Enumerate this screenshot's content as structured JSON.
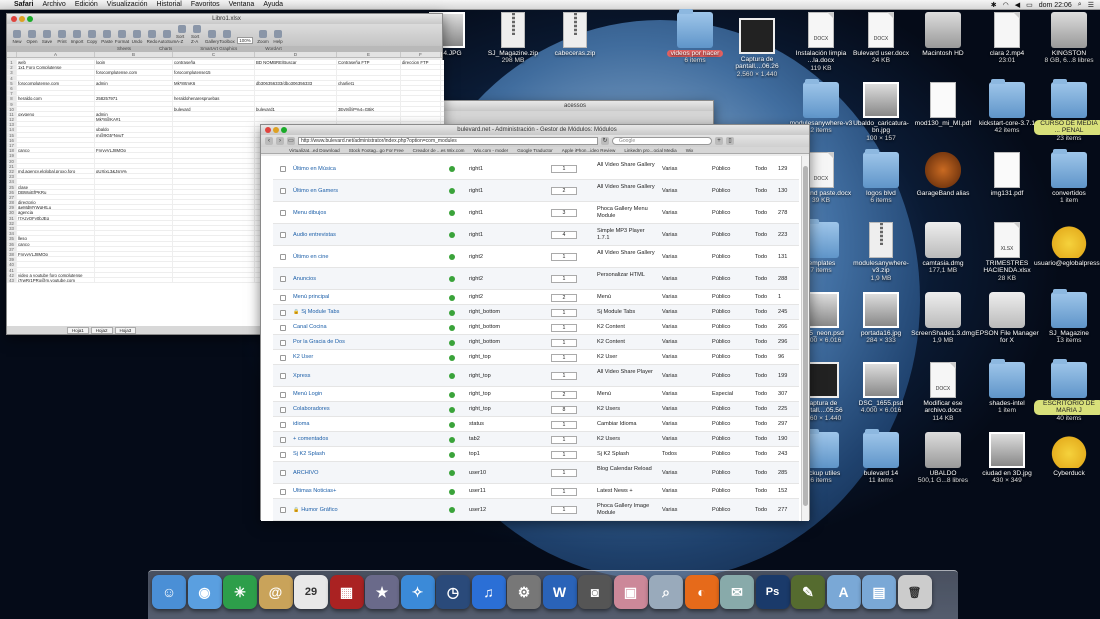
{
  "menubar": {
    "app": "Safari",
    "items": [
      "Archivo",
      "Edición",
      "Visualización",
      "Historial",
      "Favoritos",
      "Ventana",
      "Ayuda"
    ],
    "clock": "dom 22:06"
  },
  "spreadsheet": {
    "title": "Libro1.xlsx",
    "toolbar": [
      "New",
      "Open",
      "Save",
      "Print",
      "Import",
      "Copy",
      "Paste",
      "Format",
      "Undo",
      "Redo",
      "AutoSum",
      "Sort A-Z",
      "Sort Z-A",
      "Gallery",
      "Toolbox",
      "Zoom",
      "Help"
    ],
    "zoom": "100%",
    "ribbon": [
      "Sheets",
      "Charts",
      "SmartArt Graphics",
      "WordArt"
    ],
    "columns": [
      "A",
      "B",
      "C",
      "D",
      "E",
      "F"
    ],
    "headers": [
      "web",
      "login",
      "contraseña",
      "BD NOMBRE/Buscar",
      "Contraseña FTP",
      "direccion FTP"
    ],
    "rows": [
      [
        "1",
        "web",
        "login",
        "contraseña",
        "BD NOMBRE/Buscar",
        "Contraseña FTP",
        "direccion FTP"
      ],
      [
        "2",
        "1x1 Foro Complutense",
        "",
        "",
        "",
        "",
        ""
      ],
      [
        "3",
        "",
        "forocomplutense.com",
        "forocomplutense15",
        "",
        "",
        ""
      ],
      [
        "4",
        "",
        "",
        "",
        "",
        "",
        ""
      ],
      [
        "5",
        "forocomplutense.com",
        "admin",
        "Mk*8rtmK6",
        "db306356333/dbo306356333",
        "charliet1",
        ""
      ],
      [
        "6",
        "",
        "",
        "",
        "",
        "",
        ""
      ],
      [
        "7",
        "",
        "",
        "",
        "",
        "",
        ""
      ],
      [
        "8",
        "heraldo.com",
        "258257971",
        "heraldohenarespruebas",
        "",
        "",
        ""
      ],
      [
        "9",
        "",
        "",
        "",
        "",
        "",
        ""
      ],
      [
        "10",
        "",
        "",
        "bulevard",
        "bulevard1",
        "3Ev9@jP%4=G8iK",
        ""
      ],
      [
        "11",
        "oxygeno",
        "admin",
        "",
        "",
        "",
        ""
      ],
      [
        "12",
        "",
        "Mk*8@KA#1",
        "",
        "",
        "",
        ""
      ],
      [
        "13",
        "",
        "",
        "",
        "",
        "",
        ""
      ],
      [
        "14",
        "",
        "ubaldo",
        "",
        "",
        "",
        ""
      ],
      [
        "15",
        "",
        "m@9G5*NvuT",
        "",
        "",
        "",
        ""
      ],
      [
        "16",
        "",
        "",
        "",
        "",
        "",
        ""
      ],
      [
        "17",
        "",
        "",
        "",
        "",
        "",
        ""
      ],
      [
        "18",
        "canco",
        "FnrvyVLJ8MOp",
        "",
        "",
        "",
        ""
      ],
      [
        "19",
        "",
        "",
        "",
        "",
        "",
        ""
      ],
      [
        "20",
        "",
        "",
        "",
        "",
        "",
        ""
      ],
      [
        "21",
        "",
        "",
        "",
        "",
        "",
        ""
      ],
      [
        "22",
        "md,agency,elglobal,proxo,foro",
        "gUXjxL3&Jsm%",
        "",
        "",
        "",
        ""
      ],
      [
        "23",
        "",
        "",
        "",
        "",
        "",
        ""
      ],
      [
        "24",
        "",
        "",
        "",
        "",
        "",
        ""
      ],
      [
        "25",
        "clase",
        "",
        "",
        "",
        "",
        ""
      ],
      [
        "26",
        "DBWxjEfPKRu",
        "",
        "",
        "",
        "",
        ""
      ],
      [
        "27",
        "",
        "",
        "",
        "",
        "",
        ""
      ],
      [
        "28",
        "directorio",
        "",
        "",
        "",
        "",
        ""
      ],
      [
        "29",
        "&eMdMYWqHtLu",
        "",
        "",
        "",
        "",
        ""
      ],
      [
        "30",
        "agencia",
        "",
        "",
        "",
        "",
        ""
      ],
      [
        "31",
        "!7AzyOFy0bJEq",
        "",
        "",
        "",
        "",
        ""
      ],
      [
        "32",
        "",
        "",
        "",
        "",
        "",
        ""
      ],
      [
        "33",
        "",
        "",
        "",
        "",
        "",
        ""
      ],
      [
        "34",
        "",
        "",
        "",
        "",
        "",
        ""
      ],
      [
        "35",
        "lleso",
        "",
        "",
        "",
        "",
        ""
      ],
      [
        "36",
        "canco",
        "",
        "",
        "",
        "",
        ""
      ],
      [
        "37",
        "",
        "",
        "",
        "",
        "",
        ""
      ],
      [
        "38",
        "FnrvyVLJ8MOp",
        "",
        "",
        "",
        "",
        ""
      ],
      [
        "39",
        "",
        "",
        "",
        "",
        "",
        ""
      ],
      [
        "40",
        "",
        "",
        "",
        "",
        "",
        ""
      ],
      [
        "41",
        "",
        "",
        "",
        "",
        "",
        ""
      ],
      [
        "42",
        "video a youtube foro complutense",
        "",
        "",
        "",
        "",
        ""
      ],
      [
        "43",
        "j7rwRr1PRo@m.youtube.com",
        "",
        "",
        "",
        "",
        ""
      ]
    ],
    "sheets": [
      "Hoja1",
      "Hoja2",
      "Hoja3"
    ]
  },
  "browser": {
    "title": "bulevard.net - Administración - Gestor de Módulos: Módulos",
    "url": "http://www.bulevard.net/administrator/index.php?option=com_modules",
    "search_placeholder": "Google",
    "bookmarks": [
      "Virtualizat...ed Download",
      "Stock Footag...go For Free",
      "Creador de ...es Wix.com",
      "Wix.com - moder",
      "Google Traductor",
      "Apple iPhon...ideo Review",
      "LinkedIn pro...ocial Media",
      "Wix"
    ],
    "modules": [
      {
        "title": "Último en Música",
        "locked": false,
        "position": "right1",
        "order": "1",
        "type": "All Video Share Gallery",
        "pages": "Varias",
        "access": "Público",
        "lang": "Todo",
        "id": "129"
      },
      {
        "title": "Último en Gamers",
        "locked": false,
        "position": "right1",
        "order": "2",
        "type": "All Video Share Gallery",
        "pages": "Varias",
        "access": "Público",
        "lang": "Todo",
        "id": "130"
      },
      {
        "title": "Menu dibujos",
        "locked": false,
        "position": "right1",
        "order": "3",
        "type": "Phoca Gallery Menu Module",
        "pages": "Varias",
        "access": "Público",
        "lang": "Todo",
        "id": "278"
      },
      {
        "title": "Audio entrevistas",
        "locked": false,
        "position": "right1",
        "order": "4",
        "type": "Simple MP3 Player 1.7.1",
        "pages": "Varias",
        "access": "Público",
        "lang": "Todo",
        "id": "223"
      },
      {
        "title": "Último en cine",
        "locked": false,
        "position": "right2",
        "order": "1",
        "type": "All Video Share Gallery",
        "pages": "Varias",
        "access": "Público",
        "lang": "Todo",
        "id": "131"
      },
      {
        "title": "Anuncios",
        "locked": false,
        "position": "right2",
        "order": "1",
        "type": "Personalizar HTML",
        "pages": "Varias",
        "access": "Público",
        "lang": "Todo",
        "id": "288"
      },
      {
        "title": "Menú principal",
        "locked": false,
        "position": "right2",
        "order": "2",
        "type": "Menú",
        "pages": "Varias",
        "access": "Público",
        "lang": "Todo",
        "id": "1"
      },
      {
        "title": "Sj Module Tabs",
        "locked": true,
        "position": "right_bottom",
        "order": "1",
        "type": "Sj Module Tabs",
        "pages": "Varias",
        "access": "Público",
        "lang": "Todo",
        "id": "245"
      },
      {
        "title": "Canal Cocina",
        "locked": false,
        "position": "right_bottom",
        "order": "1",
        "type": "K2 Content",
        "pages": "Varias",
        "access": "Público",
        "lang": "Todo",
        "id": "266"
      },
      {
        "title": "Por la Gracia de Dos",
        "locked": false,
        "position": "right_bottom",
        "order": "1",
        "type": "K2 Content",
        "pages": "Varias",
        "access": "Público",
        "lang": "Todo",
        "id": "296"
      },
      {
        "title": "K2 User",
        "locked": false,
        "position": "right_top",
        "order": "1",
        "type": "K2 User",
        "pages": "Varias",
        "access": "Público",
        "lang": "Todo",
        "id": "96"
      },
      {
        "title": "Xpress",
        "locked": false,
        "position": "right_top",
        "order": "1",
        "type": "All Video Share Player",
        "pages": "Varias",
        "access": "Público",
        "lang": "Todo",
        "id": "199"
      },
      {
        "title": "Menú Login",
        "locked": false,
        "position": "right_top",
        "order": "2",
        "type": "Menú",
        "pages": "Varias",
        "access": "Especial",
        "lang": "Todo",
        "id": "307"
      },
      {
        "title": "Colaboradores",
        "locked": false,
        "position": "right_top",
        "order": "8",
        "type": "K2 Users",
        "pages": "Varias",
        "access": "Público",
        "lang": "Todo",
        "id": "225"
      },
      {
        "title": "idioma",
        "locked": false,
        "position": "status",
        "order": "1",
        "type": "Cambiar Idioma",
        "pages": "Varias",
        "access": "Público",
        "lang": "Todo",
        "id": "297"
      },
      {
        "title": "+ comentados",
        "locked": false,
        "position": "tab2",
        "order": "1",
        "type": "K2 Users",
        "pages": "Varias",
        "access": "Público",
        "lang": "Todo",
        "id": "190"
      },
      {
        "title": "Sj K2 Splash",
        "locked": false,
        "position": "top1",
        "order": "1",
        "type": "Sj K2 Splash",
        "pages": "Todos",
        "access": "Público",
        "lang": "Todo",
        "id": "243"
      },
      {
        "title": "ARCHIVO",
        "locked": false,
        "position": "user10",
        "order": "1",
        "type": "Blog Calendar Reload",
        "pages": "Varias",
        "access": "Público",
        "lang": "Todo",
        "id": "285"
      },
      {
        "title": "Ultimas Noticias+",
        "locked": false,
        "position": "user11",
        "order": "1",
        "type": "Latest News +",
        "pages": "Varias",
        "access": "Público",
        "lang": "Todo",
        "id": "152"
      },
      {
        "title": "Humor Gráfico",
        "locked": true,
        "position": "user12",
        "order": "1",
        "type": "Phoca Gallery Image Module",
        "pages": "Varias",
        "access": "Público",
        "lang": "Todo",
        "id": "277"
      }
    ]
  },
  "behind_window": {
    "title": "acessos"
  },
  "desktop_icons": [
    {
      "label": "1054.JPG",
      "sub": "",
      "kind": "photo"
    },
    {
      "label": "SJ_Magazine.zip",
      "sub": "298 MB",
      "kind": "zip"
    },
    {
      "label": "cabeceras.zip",
      "sub": "",
      "kind": "zip"
    },
    {
      "label": "videos por hacer",
      "sub": "6 items",
      "kind": "folder",
      "tag": "red"
    },
    {
      "label": "Captura de pantall....06.26",
      "sub": "2.560 × 1.440",
      "kind": "shot"
    },
    {
      "label": "Instalación limpia ...la.docx",
      "sub": "119 KB",
      "kind": "doc",
      "ext": "DOCX"
    },
    {
      "label": "Bulevard user.docx",
      "sub": "24 KB",
      "kind": "doc",
      "ext": "DOCX"
    },
    {
      "label": "Macintosh HD",
      "sub": "",
      "kind": "hd"
    },
    {
      "label": "clara 2.mp4",
      "sub": "23:01",
      "kind": "doc",
      "ext": ""
    },
    {
      "label": "KINGSTON",
      "sub": "8 GB, 6...8 libres",
      "kind": "hd"
    },
    {
      "label": "modulesanywhere-v3",
      "sub": "2 items",
      "kind": "folder"
    },
    {
      "label": "Ubaldo_caricatura-bn.jpg",
      "sub": "100 × 157",
      "kind": "photo"
    },
    {
      "label": "mod130_mi_MI.pdf",
      "sub": "",
      "kind": "pdf"
    },
    {
      "label": "kickstart-core-3.7.1",
      "sub": "42 items",
      "kind": "folder"
    },
    {
      "label": "CURSO DE MEDIA ... PENAL",
      "sub": "23 items",
      "kind": "folder",
      "tag": "yel"
    },
    {
      "label": "copy and paste.docx",
      "sub": "39 KB",
      "kind": "doc",
      "ext": "DOCX"
    },
    {
      "label": "logos blvd",
      "sub": "6 items",
      "kind": "folder"
    },
    {
      "label": "GarageBand alias",
      "sub": "",
      "kind": "gb"
    },
    {
      "label": "img131.pdf",
      "sub": "",
      "kind": "pdf"
    },
    {
      "label": "convertidos",
      "sub": "1 item",
      "kind": "folder"
    },
    {
      "label": "templates",
      "sub": "7 items",
      "kind": "folder"
    },
    {
      "label": "modulesanywhere-v3.zip",
      "sub": "1,9 MB",
      "kind": "zip"
    },
    {
      "label": "camtasia.dmg",
      "sub": "177,1 MB",
      "kind": "dmg"
    },
    {
      "label": "TRIMESTRES HACIENDA.xlsx",
      "sub": "28 KB",
      "kind": "doc",
      "ext": "XLSX"
    },
    {
      "label": "usuario@eglobalpress.org.duck",
      "sub": "",
      "kind": "duck"
    },
    {
      "label": "1655_neon.psd",
      "sub": "4.000 × 6.016",
      "kind": "photo"
    },
    {
      "label": "portada16.jpg",
      "sub": "284 × 333",
      "kind": "photo"
    },
    {
      "label": "ScreenShade1.3.dmg",
      "sub": "1,9 MB",
      "kind": "dmg"
    },
    {
      "label": "EPSON File Manager for X",
      "sub": "",
      "kind": "dmg"
    },
    {
      "label": "SJ_Magazine",
      "sub": "13 items",
      "kind": "folder"
    },
    {
      "label": "Captura de pantall....05.56",
      "sub": "2.560 × 1.440",
      "kind": "shot"
    },
    {
      "label": "DSC_1655.psd",
      "sub": "4.000 × 6.016",
      "kind": "photo"
    },
    {
      "label": "Modificar ese archivo.docx",
      "sub": "114 KB",
      "kind": "doc",
      "ext": "DOCX"
    },
    {
      "label": "shades-intel",
      "sub": "1 item",
      "kind": "folder"
    },
    {
      "label": "ESCRITORIO DE MARIA J",
      "sub": "40 items",
      "kind": "folder",
      "tag": "yel"
    },
    {
      "label": "backup utiles",
      "sub": "6 items",
      "kind": "folder"
    },
    {
      "label": "bulevard 14",
      "sub": "11 items",
      "kind": "folder"
    },
    {
      "label": "UBALDO",
      "sub": "500,1 G...8 libres",
      "kind": "hd"
    },
    {
      "label": "ciudad en 3D.jpg",
      "sub": "430 × 349",
      "kind": "photo"
    },
    {
      "label": "Cyberduck",
      "sub": "",
      "kind": "duck"
    }
  ],
  "dock": [
    {
      "name": "Finder",
      "icon": "finder-icon",
      "color": "#4a8fd6",
      "glyph": "☺"
    },
    {
      "name": "FaceTime",
      "icon": "facetime-icon",
      "color": "#5a9fe0",
      "glyph": "◉"
    },
    {
      "name": "Network",
      "icon": "network-icon",
      "color": "#2d9e4a",
      "glyph": "✳"
    },
    {
      "name": "Contacts",
      "icon": "contacts-icon",
      "color": "#c9a35a",
      "glyph": "@"
    },
    {
      "name": "Calendar",
      "icon": "calendar-icon",
      "color": "#e8e8e8",
      "glyph": "29"
    },
    {
      "name": "Photo Booth",
      "icon": "photobooth-icon",
      "color": "#a22",
      "glyph": "▦"
    },
    {
      "name": "iMovie",
      "icon": "imovie-icon",
      "color": "#6a6a8a",
      "glyph": "★"
    },
    {
      "name": "Safari",
      "icon": "safari-icon",
      "color": "#3b8ad8",
      "glyph": "✧"
    },
    {
      "name": "Time Machine",
      "icon": "timemachine-icon",
      "color": "#2a4a7a",
      "glyph": "◷"
    },
    {
      "name": "iTunes",
      "icon": "itunes-icon",
      "color": "#2b6fd6",
      "glyph": "♫"
    },
    {
      "name": "System Preferences",
      "icon": "settings-icon",
      "color": "#777",
      "glyph": "⚙"
    },
    {
      "name": "Word",
      "icon": "word-icon",
      "color": "#2a63b8",
      "glyph": "W"
    },
    {
      "name": "Image Capture",
      "icon": "camera-icon",
      "color": "#555",
      "glyph": "◙"
    },
    {
      "name": "iPhoto",
      "icon": "photos-icon",
      "color": "#c89",
      "glyph": "▣"
    },
    {
      "name": "Preview",
      "icon": "preview-icon",
      "color": "#9ab",
      "glyph": "⌕"
    },
    {
      "name": "Firefox",
      "icon": "firefox-icon",
      "color": "#e66a1a",
      "glyph": "◐"
    },
    {
      "name": "Mail Stamp",
      "icon": "stamp-icon",
      "color": "#8aa",
      "glyph": "✉"
    },
    {
      "name": "Photoshop",
      "icon": "photoshop-icon",
      "color": "#1a3a6a",
      "glyph": "Ps"
    },
    {
      "name": "Script",
      "icon": "script-icon",
      "color": "#556b2f",
      "glyph": "✎"
    },
    {
      "name": "Applications",
      "icon": "applications-folder-icon",
      "color": "#7aa8d6",
      "glyph": "A"
    },
    {
      "name": "Documents",
      "icon": "documents-folder-icon",
      "color": "#7aa8d6",
      "glyph": "▤"
    },
    {
      "name": "Trash",
      "icon": "trash-icon",
      "color": "#ccc",
      "glyph": "🗑"
    }
  ]
}
